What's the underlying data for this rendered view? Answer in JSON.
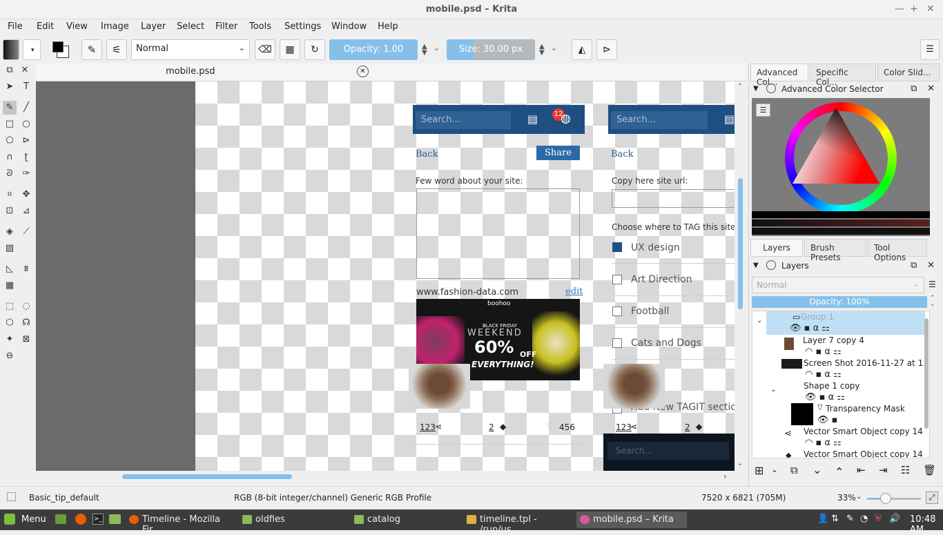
{
  "window": {
    "title": "mobile.psd – Krita"
  },
  "menu": [
    "File",
    "Edit",
    "View",
    "Image",
    "Layer",
    "Select",
    "Filter",
    "Tools",
    "Settings",
    "Window",
    "Help"
  ],
  "toolbar": {
    "blend_mode": "Normal",
    "opacity_label": "Opacity:",
    "opacity_value": "1.00",
    "size_label": "Size:",
    "size_value": "30.00 px"
  },
  "document": {
    "tab_title": "mobile.psd"
  },
  "canvas": {
    "left_mock": {
      "search_placeholder": "Search...",
      "badge": "12",
      "back": "Back",
      "share": "Share",
      "about_label": "Few word about your site:",
      "site_url": "www.fashion-data.com",
      "edit": "edit",
      "promo_brand": "boohoo",
      "promo_line1": "BLACK FRIDAY",
      "promo_line2": "WEEKEND",
      "promo_big": "60%",
      "promo_off": "OFF",
      "promo_every": "EVERYTHING!",
      "stat_shares": "123",
      "stat_tags": "2",
      "stat_likes": "456"
    },
    "right_mock": {
      "search_placeholder": "Search...",
      "back": "Back",
      "url_label": "Copy here site url:",
      "tag_label": "Choose where to TAG this site",
      "options": [
        "UX design",
        "Art Direction",
        "Football",
        "Cats and Dogs"
      ],
      "add_section": "Add New TAGIT section",
      "stat_shares": "123",
      "stat_tags": "2",
      "search_bottom": "Search..."
    }
  },
  "right_panel": {
    "color_tabs": [
      "Advanced Col...",
      "Specific Col...",
      "Color Slid..."
    ],
    "color_selector_title": "Advanced Color Selector",
    "layer_tabs": [
      "Layers",
      "Brush Presets",
      "Tool Options"
    ],
    "layers_title": "Layers",
    "blend": "Normal",
    "opacity": "Opacity:  100%",
    "layers": [
      "Group 1",
      "Layer 7 copy 4",
      "Screen Shot 2016-11-27 at 1...",
      "Shape 1 copy",
      "Transparency Mask",
      "Vector Smart Object copy 14",
      "Vector Smart Object copy 14"
    ]
  },
  "status": {
    "brush": "Basic_tip_default",
    "color_profile": "RGB (8-bit integer/channel)  Generic RGB Profile",
    "dimensions": "7520 x 6821 (705M)",
    "zoom": "33%"
  },
  "taskbar": {
    "menu": "Menu",
    "tasks": [
      "Timeline - Mozilla Fir...",
      "oldfies",
      "catalog",
      "timeline.tpl - /run/us...",
      "mobile.psd – Krita"
    ],
    "time": "10:48 AM"
  },
  "colors": {
    "accent": "#86c0ea",
    "nav_blue": "#1e4f80",
    "layer_selected": "#bfdff5"
  }
}
